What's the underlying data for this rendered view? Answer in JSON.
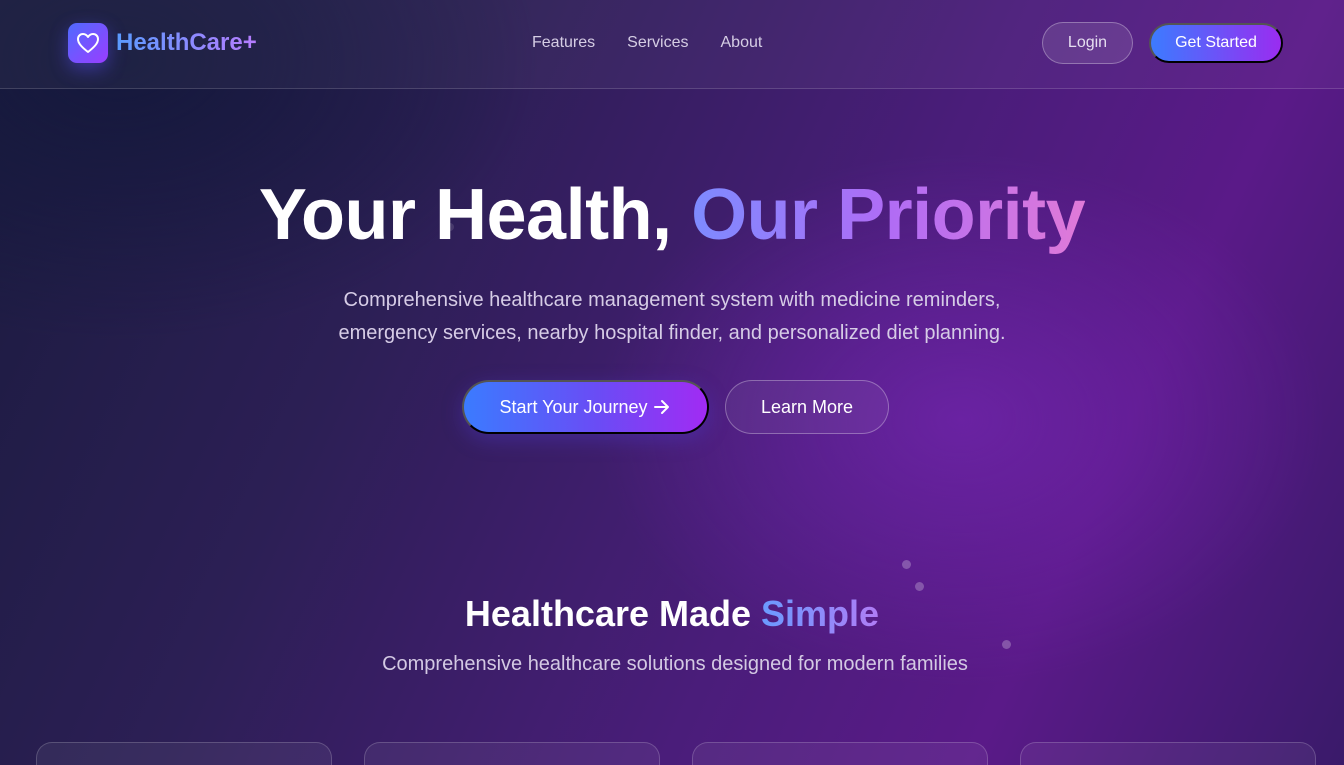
{
  "brand": {
    "name": "HealthCare+",
    "icon": "heart-icon"
  },
  "nav": {
    "links": [
      {
        "label": "Features"
      },
      {
        "label": "Services"
      },
      {
        "label": "About"
      }
    ],
    "login_label": "Login",
    "get_started_label": "Get Started"
  },
  "hero": {
    "title_main": "Your Health, ",
    "title_accent": "Our Priority",
    "subtitle_line1": "Comprehensive healthcare management system with medicine reminders,",
    "subtitle_line2": "emergency services, nearby hospital finder, and personalized diet planning.",
    "primary_cta": "Start Your Journey",
    "primary_cta_icon": "arrow-right-icon",
    "secondary_cta": "Learn More"
  },
  "section": {
    "title_main": "Healthcare Made ",
    "title_accent": "Simple",
    "subtitle": "Comprehensive healthcare solutions designed for modern families"
  },
  "colors": {
    "primary_gradient_start": "#3b7bff",
    "primary_gradient_end": "#a12bf3",
    "background_dark": "#1a1b3e",
    "background_purple": "#5a1a88"
  }
}
